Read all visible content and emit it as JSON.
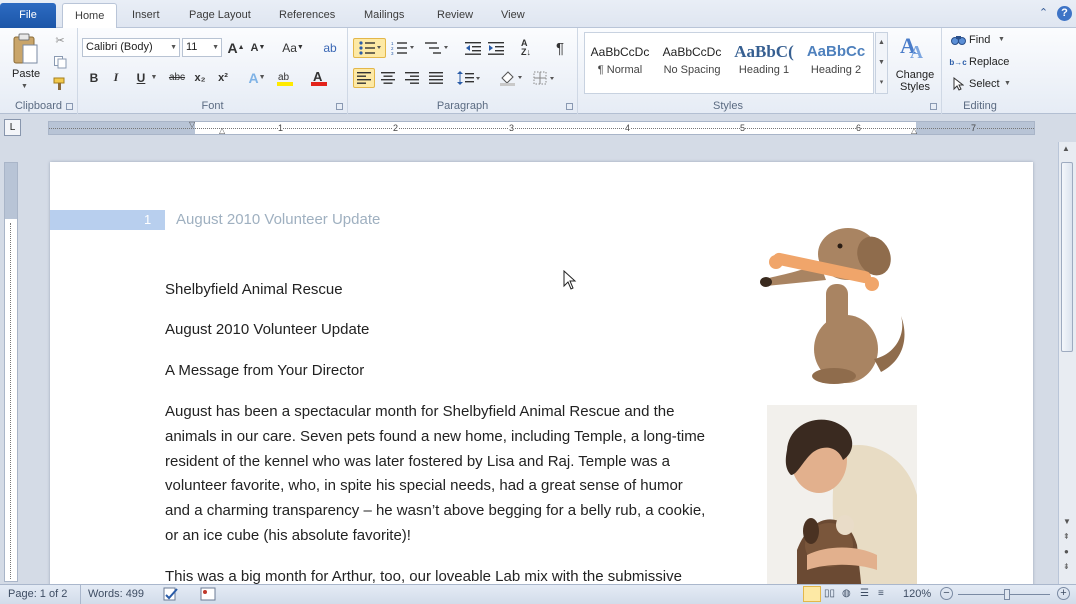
{
  "tabs": {
    "file": "File",
    "items": [
      "Home",
      "Insert",
      "Page Layout",
      "References",
      "Mailings",
      "Review",
      "View"
    ]
  },
  "clipboard": {
    "paste": "Paste",
    "label": "Clipboard"
  },
  "font": {
    "name": "Calibri (Body)",
    "size": "11",
    "label": "Font",
    "bold": "B",
    "italic": "I",
    "underline": "U",
    "strike": "abc",
    "sub": "x₂",
    "sup": "x²",
    "grow": "A",
    "shrink": "A",
    "case": "Aa",
    "color_letter": "A"
  },
  "paragraph": {
    "label": "Paragraph",
    "pilcrow": "¶"
  },
  "styles": {
    "label": "Styles",
    "items": [
      {
        "preview": "AaBbCcDc",
        "name": "¶ Normal"
      },
      {
        "preview": "AaBbCcDc",
        "name": "No Spacing"
      },
      {
        "preview": "AaBbC(",
        "name": "Heading 1"
      },
      {
        "preview": "AaBbCc",
        "name": "Heading 2"
      }
    ],
    "change": "Change Styles"
  },
  "editing": {
    "label": "Editing",
    "find": "Find",
    "replace": "Replace",
    "select": "Select"
  },
  "ruler": {
    "numbers": [
      "1",
      "2",
      "3",
      "4",
      "5",
      "6",
      "7"
    ]
  },
  "document": {
    "nav_number": "1",
    "heading": "August 2010 Volunteer Update",
    "lines": [
      "Shelbyfield Animal Rescue",
      "August 2010 Volunteer Update",
      "A Message from Your Director"
    ],
    "paragraph1": [
      "August has been a spectacular month for Shelbyfield Animal Rescue and the",
      "animals in our care. Seven pets found a new home, including Temple, a long-time",
      "resident of the kennel who was later fostered by Lisa and Raj. Temple was a",
      "volunteer favorite, who, in spite his special needs, had a great sense of humor",
      "and a charming transparency – he wasn’t above begging for a belly rub, a cookie,",
      "or an ice cube (his absolute favorite)!"
    ],
    "paragraph2": "This was a big month for Arthur, too, our loveable Lab mix with the submissive"
  },
  "status": {
    "page": "Page: 1 of 2",
    "words": "Words: 499",
    "zoom": "120%"
  },
  "colors": {
    "accent": "#2d6bc2",
    "highlight": "#fde9a5",
    "heading": "#9fb0c0"
  }
}
